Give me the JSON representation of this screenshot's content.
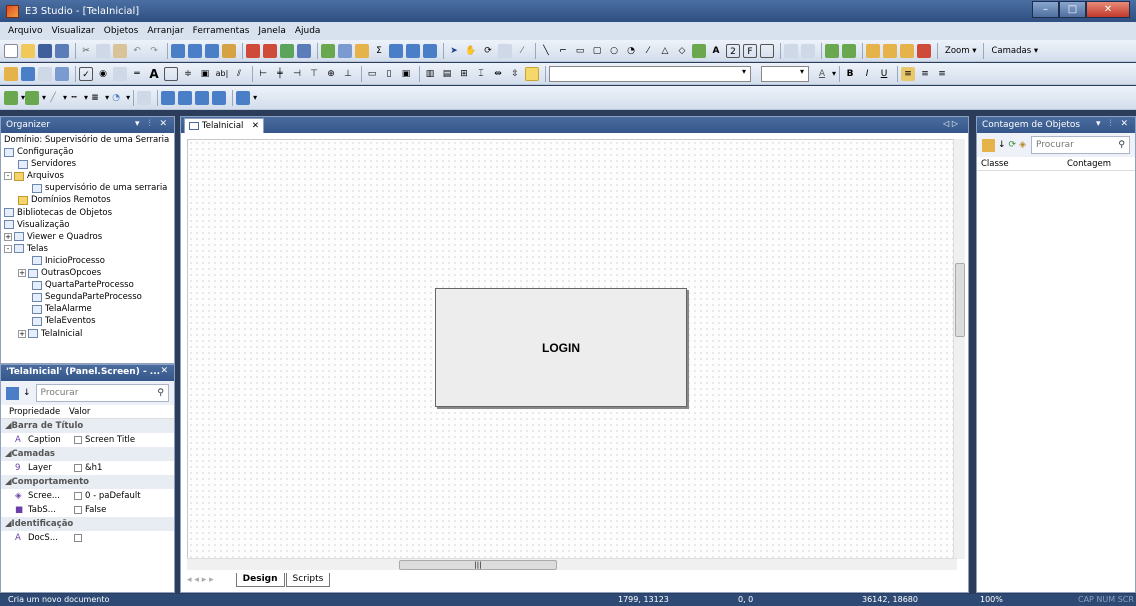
{
  "window": {
    "title": "E3 Studio - [TelaInicial]"
  },
  "menu": [
    "Arquivo",
    "Visualizar",
    "Objetos",
    "Arranjar",
    "Ferramentas",
    "Janela",
    "Ajuda"
  ],
  "toolbar": {
    "zoom_label": "Zoom",
    "layers_label": "Camadas",
    "bold": "B",
    "italic": "I",
    "underline": "U"
  },
  "organizer": {
    "title": "Organizer",
    "items": [
      {
        "label": "Domínio: Supervisório de uma Serraria",
        "icon": "none",
        "indent": 0
      },
      {
        "label": "Configuração",
        "icon": "config-icon",
        "indent": 0
      },
      {
        "label": "Servidores",
        "icon": "server-icon",
        "indent": 1
      },
      {
        "label": "Arquivos",
        "icon": "folder-icon",
        "indent": 0,
        "expand": "-"
      },
      {
        "label": "supervisório de uma serraria",
        "icon": "project-icon",
        "indent": 2
      },
      {
        "label": "Domínios Remotos",
        "icon": "folder-icon",
        "indent": 1
      },
      {
        "label": "Bibliotecas de Objetos",
        "icon": "library-icon",
        "indent": 0
      },
      {
        "label": "Visualização",
        "icon": "view-icon",
        "indent": 0
      },
      {
        "label": "Viewer e Quadros",
        "icon": "viewer-icon",
        "indent": 0,
        "expand": "+"
      },
      {
        "label": "Telas",
        "icon": "screens-icon",
        "indent": 0,
        "expand": "-"
      },
      {
        "label": "InicioProcesso",
        "icon": "screen-icon",
        "indent": 2
      },
      {
        "label": "OutrasOpcoes",
        "icon": "screen-icon",
        "indent": 1,
        "expand": "+"
      },
      {
        "label": "QuartaParteProcesso",
        "icon": "screen-icon",
        "indent": 2
      },
      {
        "label": "SegundaParteProcesso",
        "icon": "screen-icon",
        "indent": 2
      },
      {
        "label": "TelaAlarme",
        "icon": "screen-icon",
        "indent": 2
      },
      {
        "label": "TelaEventos",
        "icon": "screen-icon",
        "indent": 2
      },
      {
        "label": "TelaInicial",
        "icon": "screen-icon",
        "indent": 1,
        "expand": "+"
      }
    ]
  },
  "properties": {
    "title": "'TelaInicial' (Panel.Screen) - ...",
    "search_placeholder": "Procurar",
    "col_prop": "Propriedade",
    "col_value": "Valor",
    "rows": [
      {
        "type": "cat",
        "label": "Barra de Título"
      },
      {
        "type": "row",
        "icon": "A",
        "name": "Caption",
        "value": "Screen Title"
      },
      {
        "type": "cat",
        "label": "Camadas"
      },
      {
        "type": "row",
        "icon": "9",
        "name": "Layer",
        "value": "&h1"
      },
      {
        "type": "cat",
        "label": "Comportamento"
      },
      {
        "type": "row",
        "icon": "◈",
        "name": "Scree...",
        "value": "0 - paDefault"
      },
      {
        "type": "row",
        "icon": "■",
        "name": "TabS...",
        "value": "False"
      },
      {
        "type": "cat",
        "label": "Identificação"
      },
      {
        "type": "row",
        "icon": "A",
        "name": "DocS...",
        "value": ""
      }
    ]
  },
  "document": {
    "tab_label": "TelaInicial",
    "login_label": "LOGIN",
    "bottom_tabs": [
      "Design",
      "Scripts"
    ]
  },
  "object_count": {
    "title": "Contagem de Objetos",
    "search_placeholder": "Procurar",
    "col_class": "Classe",
    "col_count": "Contagem"
  },
  "status": {
    "message": "Cria um novo documento",
    "cursor": "1799, 13123",
    "position": "0, 0",
    "size": "36142, 18680",
    "zoom": "100%",
    "keys": "CAP NUM SCR"
  },
  "colors": {
    "accent": "#35568a",
    "statusbar": "#2e4a74"
  }
}
